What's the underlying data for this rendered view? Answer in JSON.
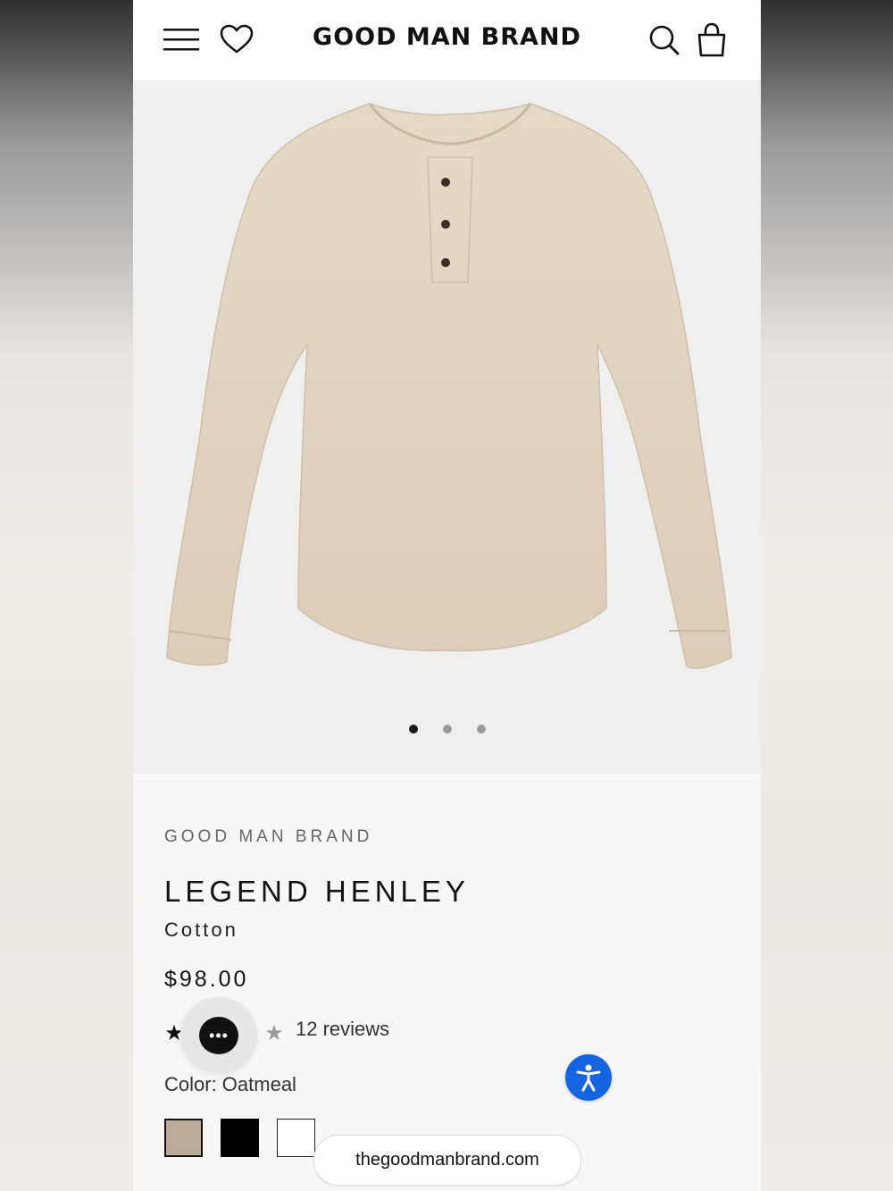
{
  "header": {
    "logo": "GOOD MAN BRAND",
    "menu_icon": "menu-icon",
    "wishlist_icon": "heart-icon",
    "search_icon": "search-icon",
    "cart_icon": "shopping-bag-icon"
  },
  "gallery": {
    "image": "oatmeal henley shirt",
    "slides": 3,
    "active_slide": 1
  },
  "product": {
    "vendor": "GOOD MAN BRAND",
    "title": "LEGEND HENLEY",
    "subtitle": "Cotton",
    "price": "$98.00",
    "rating": 4.5,
    "reviews_label": "12 reviews",
    "color_label": "Color: Oatmeal",
    "swatches": [
      {
        "name": "Oatmeal",
        "color": "#b9ab98"
      },
      {
        "name": "Black",
        "color": "#000000"
      },
      {
        "name": "White",
        "color": "#ffffff"
      }
    ]
  },
  "overlay": {
    "url": "thegoodmanbrand.com",
    "chat_icon": "chat-icon",
    "accessibility_icon": "accessibility-icon"
  },
  "colors": {
    "accessibility_blue": "#1565e0",
    "swatch_oatmeal": "#b9ab98"
  }
}
